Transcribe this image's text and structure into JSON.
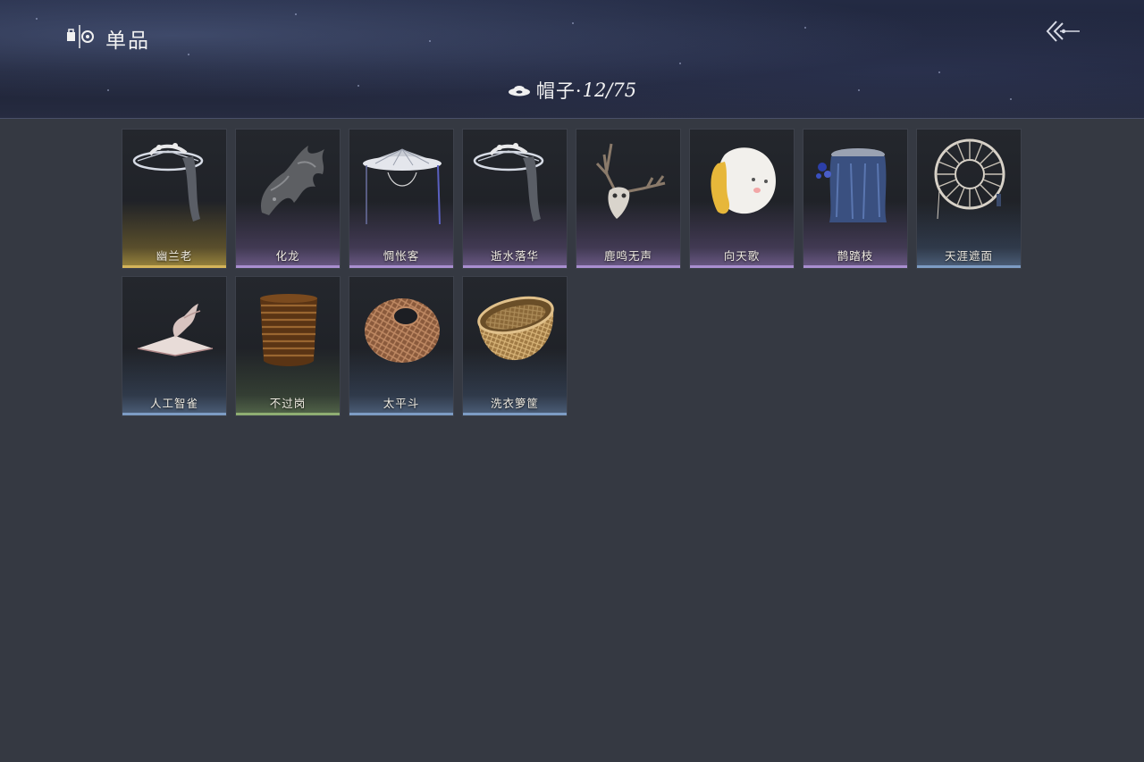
{
  "header": {
    "title": "单品",
    "logo_icon": "wardrobe-icon",
    "back_icon": "back-arrow-icon"
  },
  "category": {
    "icon": "hat-icon",
    "name": "帽子·",
    "count": "12/75"
  },
  "items": [
    {
      "name": "幽兰老",
      "rarity": "gold",
      "icon": "ornate-bamboo-hat-icon"
    },
    {
      "name": "化龙",
      "rarity": "purple",
      "icon": "dragon-head-icon"
    },
    {
      "name": "惆怅客",
      "rarity": "purple",
      "icon": "veiled-hat-icon"
    },
    {
      "name": "逝水落华",
      "rarity": "purple",
      "icon": "ornate-bamboo-hat-icon"
    },
    {
      "name": "鹿鸣无声",
      "rarity": "purple",
      "icon": "deer-skull-icon"
    },
    {
      "name": "向天歌",
      "rarity": "purple",
      "icon": "goose-hood-icon"
    },
    {
      "name": "鹊踏枝",
      "rarity": "purple",
      "icon": "blue-veil-hat-icon"
    },
    {
      "name": "天涯遮面",
      "rarity": "blue",
      "icon": "woven-round-hat-icon"
    },
    {
      "name": "人工智雀",
      "rarity": "blue",
      "icon": "bird-hat-icon"
    },
    {
      "name": "不过岗",
      "rarity": "green",
      "icon": "bowl-stack-icon"
    },
    {
      "name": "太平斗",
      "rarity": "blue",
      "icon": "wicker-basket-icon"
    },
    {
      "name": "洗衣箩筐",
      "rarity": "blue",
      "icon": "laundry-basket-icon"
    }
  ],
  "colors": {
    "background": "#353942",
    "gold": "#d4b45a",
    "purple": "#a98fd0",
    "blue": "#7d9cc4",
    "green": "#8fae72"
  }
}
